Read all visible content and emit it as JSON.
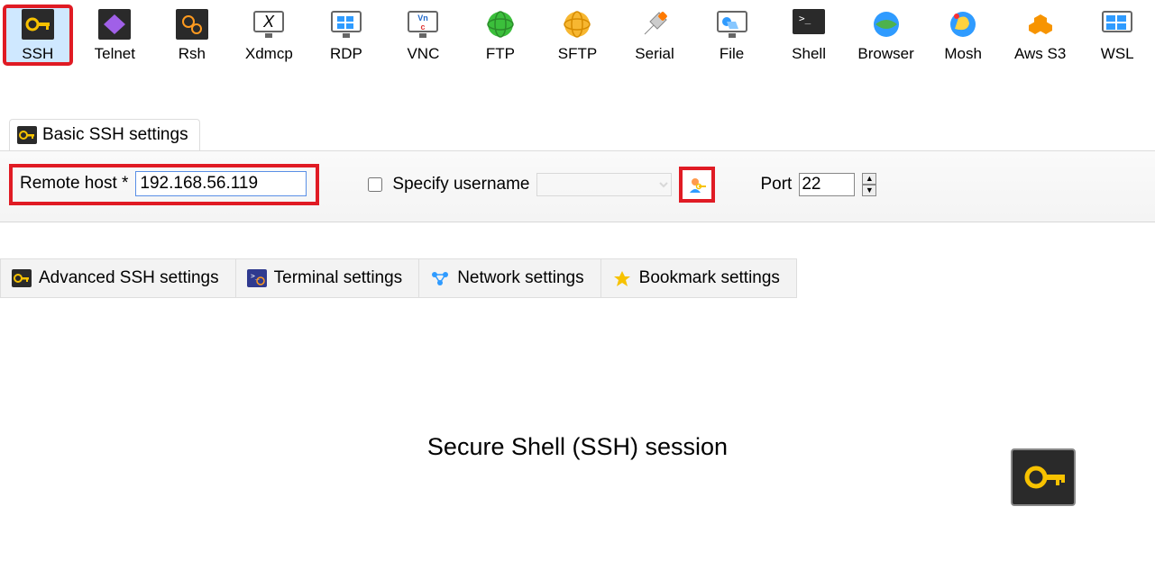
{
  "toolbar": [
    {
      "label": "SSH",
      "icon": "key"
    },
    {
      "label": "Telnet",
      "icon": "diamond"
    },
    {
      "label": "Rsh",
      "icon": "gears"
    },
    {
      "label": "Xdmcp",
      "icon": "xmon"
    },
    {
      "label": "RDP",
      "icon": "rdp"
    },
    {
      "label": "VNC",
      "icon": "vnc"
    },
    {
      "label": "FTP",
      "icon": "globe-green"
    },
    {
      "label": "SFTP",
      "icon": "globe-orange"
    },
    {
      "label": "Serial",
      "icon": "plug"
    },
    {
      "label": "File",
      "icon": "file"
    },
    {
      "label": "Shell",
      "icon": "shell"
    },
    {
      "label": "Browser",
      "icon": "browser"
    },
    {
      "label": "Mosh",
      "icon": "mosh"
    },
    {
      "label": "Aws S3",
      "icon": "aws"
    },
    {
      "label": "WSL",
      "icon": "wsl"
    }
  ],
  "basic_tab": {
    "label": "Basic SSH settings"
  },
  "host": {
    "label": "Remote host *",
    "value": "192.168.56.119"
  },
  "user": {
    "label": "Specify username",
    "value": ""
  },
  "port": {
    "label": "Port",
    "value": "22"
  },
  "settings_tabs": [
    {
      "label": "Advanced SSH settings",
      "icon": "key-small"
    },
    {
      "label": "Terminal settings",
      "icon": "terminal"
    },
    {
      "label": "Network settings",
      "icon": "network"
    },
    {
      "label": "Bookmark settings",
      "icon": "star"
    }
  ],
  "footer": {
    "title": "Secure Shell (SSH) session"
  }
}
